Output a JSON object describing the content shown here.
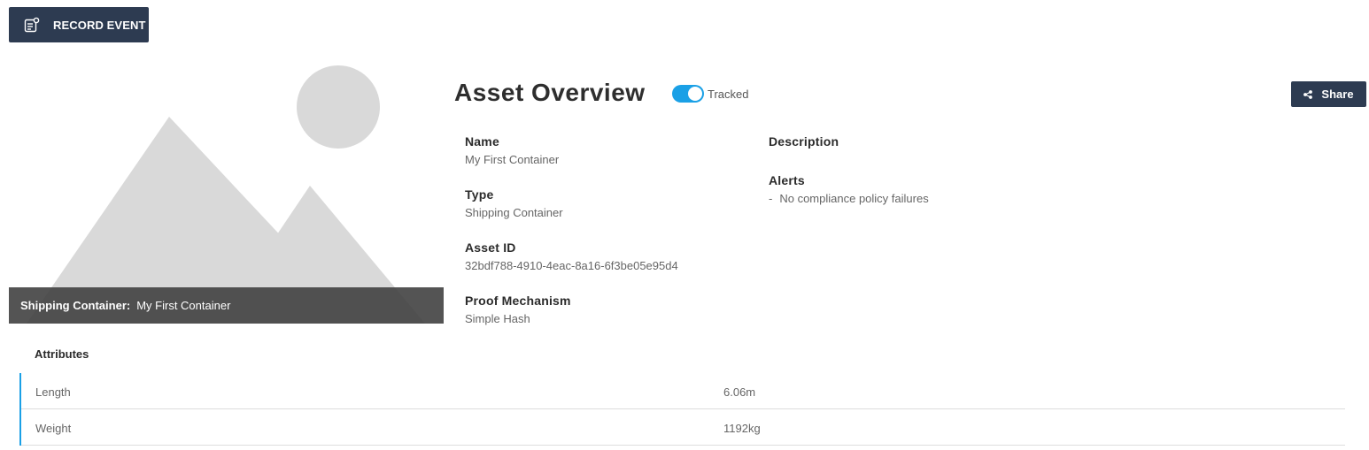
{
  "toolbar": {
    "record_event_label": "RECORD EVENT"
  },
  "image": {
    "caption_type": "Shipping Container:",
    "caption_name": "My First Container"
  },
  "header": {
    "title": "Asset Overview",
    "tracked_label": "Tracked",
    "tracked_on": true,
    "share_label": "Share"
  },
  "fields": {
    "name": {
      "label": "Name",
      "value": "My First Container"
    },
    "type": {
      "label": "Type",
      "value": "Shipping Container"
    },
    "asset_id": {
      "label": "Asset ID",
      "value": "32bdf788-4910-4eac-8a16-6f3be05e95d4"
    },
    "proof": {
      "label": "Proof Mechanism",
      "value": "Simple Hash"
    },
    "description": {
      "label": "Description"
    },
    "alerts": {
      "label": "Alerts",
      "items": [
        "No compliance policy failures"
      ],
      "bullet": "-"
    }
  },
  "attributes": {
    "title": "Attributes",
    "rows": [
      {
        "name": "Length",
        "value": "6.06m"
      },
      {
        "name": "Weight",
        "value": "1192kg"
      }
    ]
  },
  "colors": {
    "button_bg": "#2d3b51",
    "accent": "#1aa0e6",
    "placeholder_gray": "#d9d9d9"
  },
  "icons": {
    "record_event": "record-event-icon",
    "share": "share-icon",
    "image_placeholder": "image-placeholder-icon"
  }
}
